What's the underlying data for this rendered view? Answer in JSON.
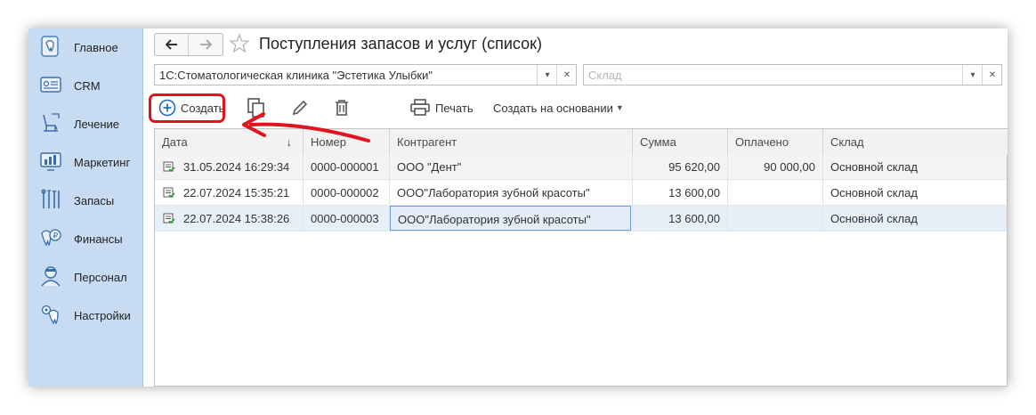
{
  "sidebar": {
    "items": [
      {
        "label": "Главное",
        "icon": "tooth-home-icon"
      },
      {
        "label": "CRM",
        "icon": "id-card-icon"
      },
      {
        "label": "Лечение",
        "icon": "dental-chair-icon"
      },
      {
        "label": "Маркетинг",
        "icon": "chart-monitor-icon"
      },
      {
        "label": "Запасы",
        "icon": "dental-tools-icon"
      },
      {
        "label": "Финансы",
        "icon": "tooth-money-icon"
      },
      {
        "label": "Персонал",
        "icon": "doctor-icon"
      },
      {
        "label": "Настройки",
        "icon": "tooth-gear-icon"
      }
    ]
  },
  "header": {
    "title": "Поступления запасов и услуг (список)"
  },
  "filters": {
    "organization": "1С:Стоматологическая клиника \"Эстетика Улыбки\"",
    "warehouse_placeholder": "Склад"
  },
  "toolbar": {
    "create_label": "Создать",
    "print_label": "Печать",
    "create_based_label": "Создать на основании"
  },
  "table": {
    "columns": [
      "Дата",
      "Номер",
      "Контрагент",
      "Сумма",
      "Оплачено",
      "Склад"
    ],
    "sort_indicator": "↓",
    "rows": [
      {
        "date": "31.05.2024 16:29:34",
        "number": "0000-000001",
        "counterparty": "ООО \"Дент\"",
        "sum": "95 620,00",
        "paid": "90 000,00",
        "warehouse": "Основной склад"
      },
      {
        "date": "22.07.2024 15:35:21",
        "number": "0000-000002",
        "counterparty": "ООО\"Лаборатория зубной красоты\"",
        "sum": "13 600,00",
        "paid": "",
        "warehouse": "Основной склад"
      },
      {
        "date": "22.07.2024 15:38:26",
        "number": "0000-000003",
        "counterparty": "ООО\"Лаборатория зубной красоты\"",
        "sum": "13 600,00",
        "paid": "",
        "warehouse": "Основной склад"
      }
    ]
  },
  "colors": {
    "sidebar_bg": "#c7dcf3",
    "highlight": "#e0141e",
    "accent": "#1f6fc5",
    "selected_row": "#e7eff8"
  }
}
